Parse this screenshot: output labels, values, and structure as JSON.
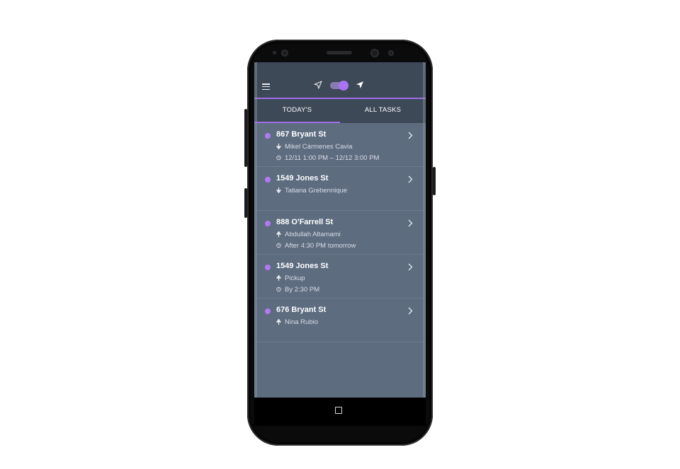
{
  "app": {
    "colors": {
      "accent": "#a06dea",
      "header": "#3e4957",
      "list_bg": "#5e6c80",
      "dot": "#b07af3"
    }
  },
  "header": {
    "menu_icon": "hamburger-menu-icon",
    "location_off_icon": "navigation-outline-icon",
    "location_on_icon": "navigation-filled-icon",
    "tracking_toggle_on": true
  },
  "tabs": [
    {
      "label": "TODAY'S",
      "active": true
    },
    {
      "label": "ALL TASKS",
      "active": false
    }
  ],
  "tasks": [
    {
      "address": "867 Bryant St",
      "direction": "down",
      "person": "Mikel Cármenes Cavia",
      "time": "12/11 1:00 PM – 12/12 3:00 PM"
    },
    {
      "address": "1549 Jones St",
      "direction": "down",
      "person": "Tatiana Grebennique",
      "time": ""
    },
    {
      "address": "888 O'Farrell St",
      "direction": "up",
      "person": "Abdullah Altamami",
      "time": "After 4:30 PM tomorrow"
    },
    {
      "address": "1549 Jones St",
      "direction": "up",
      "person": "Pickup",
      "time": "By 2:30 PM"
    },
    {
      "address": "676 Bryant St",
      "direction": "up",
      "person": "Nina Rubio",
      "time": ""
    }
  ],
  "system_nav": {
    "home_icon": "square-home-icon"
  }
}
